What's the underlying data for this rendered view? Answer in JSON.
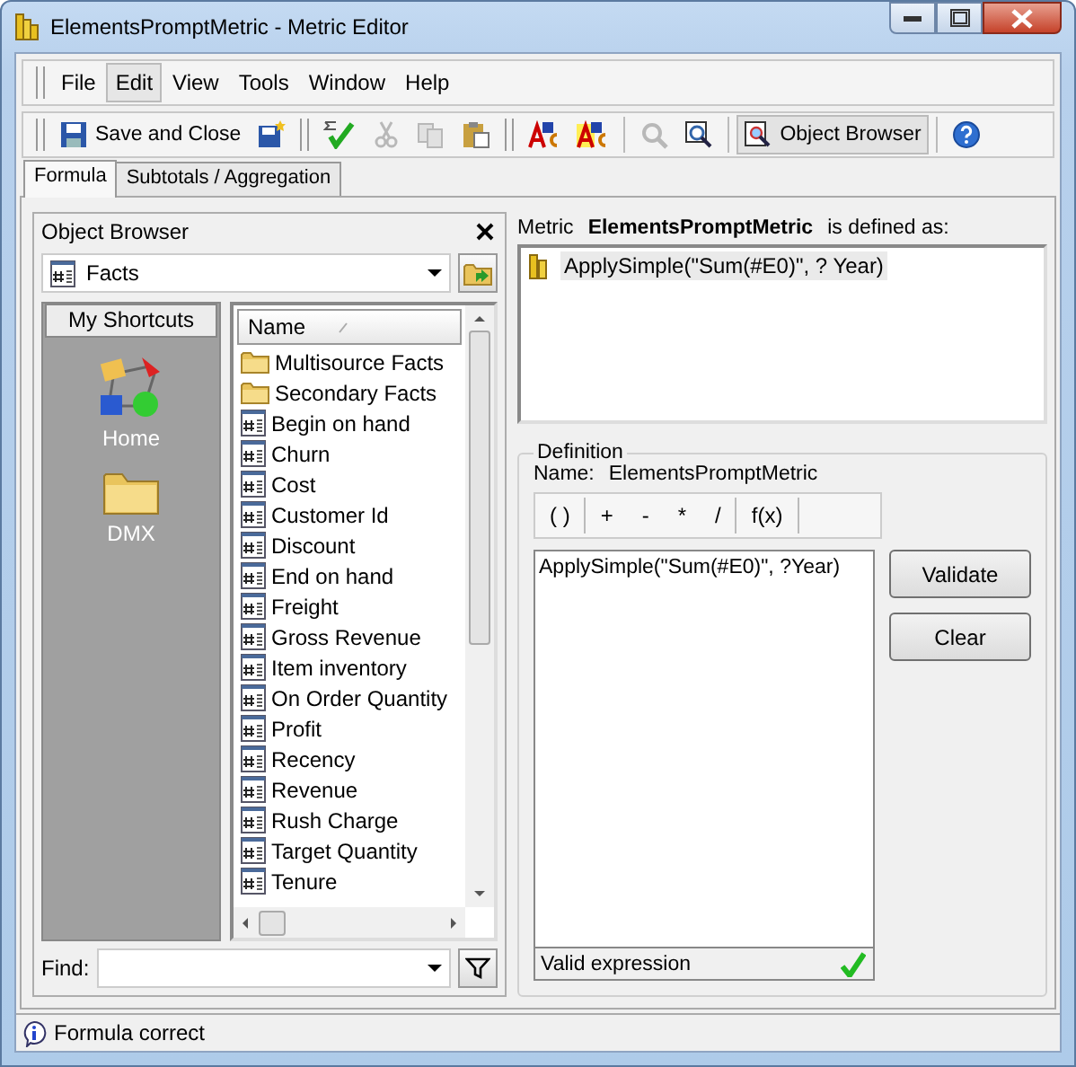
{
  "window": {
    "title": "ElementsPromptMetric - Metric Editor"
  },
  "menu": [
    {
      "label": "File",
      "highlighted": false
    },
    {
      "label": "Edit",
      "highlighted": true
    },
    {
      "label": "View",
      "highlighted": false
    },
    {
      "label": "Tools",
      "highlighted": false
    },
    {
      "label": "Window",
      "highlighted": false
    },
    {
      "label": "Help",
      "highlighted": false
    }
  ],
  "toolbar": [
    {
      "kind": "grip"
    },
    {
      "kind": "save",
      "label": "Save and Close",
      "disabled": false,
      "pressed": false
    },
    {
      "kind": "save-new",
      "disabled": false,
      "pressed": false
    },
    {
      "kind": "grip"
    },
    {
      "kind": "sum-check",
      "disabled": false,
      "pressed": false
    },
    {
      "kind": "cut",
      "disabled": true,
      "pressed": false
    },
    {
      "kind": "copy",
      "disabled": true,
      "pressed": false
    },
    {
      "kind": "paste",
      "disabled": false,
      "pressed": false
    },
    {
      "kind": "grip"
    },
    {
      "kind": "abc",
      "disabled": false,
      "pressed": false
    },
    {
      "kind": "abc-alt",
      "disabled": false,
      "pressed": false
    },
    {
      "kind": "separator"
    },
    {
      "kind": "zoom-object",
      "disabled": true,
      "pressed": false
    },
    {
      "kind": "zoom-frame",
      "disabled": false,
      "pressed": false
    },
    {
      "kind": "separator"
    },
    {
      "kind": "object-browser",
      "label": "Object Browser",
      "disabled": false,
      "pressed": true
    },
    {
      "kind": "separator"
    },
    {
      "kind": "help",
      "disabled": false,
      "pressed": false
    }
  ],
  "tabs": [
    {
      "label": "Formula",
      "selected": true
    },
    {
      "label": "Subtotals / Aggregation",
      "selected": false
    }
  ],
  "object_browser": {
    "title": "Object Browser",
    "folder": "Facts",
    "shortcuts_title": "My Shortcuts",
    "shortcuts": [
      {
        "label": "Home",
        "kind": "home"
      },
      {
        "label": "DMX",
        "kind": "folder"
      }
    ],
    "column": "Name",
    "items": [
      {
        "label": "Multisource Facts",
        "kind": "folder"
      },
      {
        "label": "Secondary Facts",
        "kind": "folder"
      },
      {
        "label": "Begin on hand",
        "kind": "metric"
      },
      {
        "label": "Churn",
        "kind": "metric"
      },
      {
        "label": "Cost",
        "kind": "metric"
      },
      {
        "label": "Customer Id",
        "kind": "metric"
      },
      {
        "label": "Discount",
        "kind": "metric"
      },
      {
        "label": "End on hand",
        "kind": "metric"
      },
      {
        "label": "Freight",
        "kind": "metric"
      },
      {
        "label": "Gross Revenue",
        "kind": "metric"
      },
      {
        "label": "Item inventory",
        "kind": "metric"
      },
      {
        "label": "On Order Quantity",
        "kind": "metric"
      },
      {
        "label": "Profit",
        "kind": "metric"
      },
      {
        "label": "Recency",
        "kind": "metric"
      },
      {
        "label": "Revenue",
        "kind": "metric"
      },
      {
        "label": "Rush Charge",
        "kind": "metric"
      },
      {
        "label": "Target Quantity",
        "kind": "metric"
      },
      {
        "label": "Tenure",
        "kind": "metric"
      }
    ],
    "find_label": "Find:"
  },
  "metric": {
    "prefix": "Metric",
    "name": "ElementsPromptMetric",
    "suffix": "is defined as:",
    "tree_item": "ApplySimple(\"Sum(#E0)\", ? Year)"
  },
  "definition": {
    "legend": "Definition",
    "name_label": "Name:",
    "name_value": "ElementsPromptMetric",
    "operator_groups": [
      [
        "( )"
      ],
      [
        "+",
        "-",
        "*",
        "/"
      ],
      [
        "f(x)"
      ]
    ],
    "expression": "ApplySimple(\"Sum(#E0)\", ?Year)",
    "buttons": [
      "Validate",
      "Clear"
    ],
    "validation": "Valid expression",
    "valid": true
  },
  "status_bar": {
    "text": "Formula correct"
  }
}
